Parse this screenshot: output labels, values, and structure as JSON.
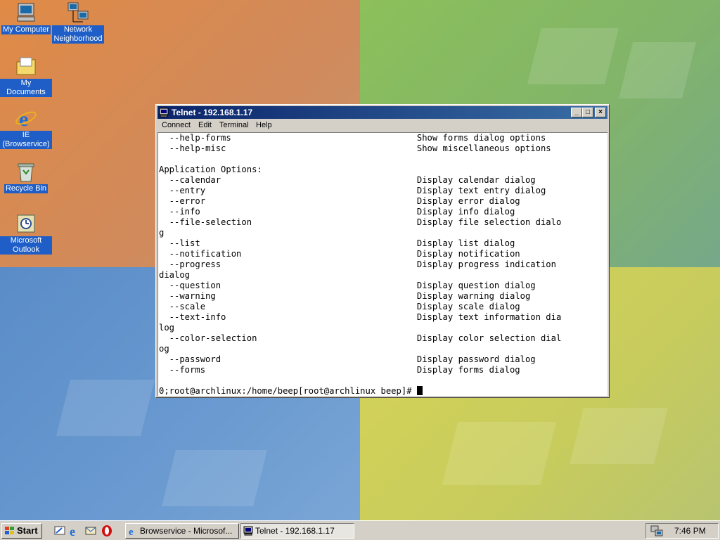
{
  "desktop": {
    "icons": [
      {
        "label": "My Computer",
        "icon": "my-computer-icon"
      },
      {
        "label": "Network Neighborhood",
        "icon": "network-neighborhood-icon"
      },
      {
        "label": "My Documents",
        "icon": "my-documents-icon"
      },
      {
        "label": "IE (Browservice)",
        "icon": "internet-explorer-icon"
      },
      {
        "label": "Recycle Bin",
        "icon": "recycle-bin-icon"
      },
      {
        "label": "Microsoft Outlook",
        "icon": "outlook-icon"
      }
    ]
  },
  "window": {
    "title": "Telnet - 192.168.1.17",
    "buttons": {
      "minimize": "_",
      "maximize": "□",
      "close": "×"
    },
    "menu": [
      "Connect",
      "Edit",
      "Terminal",
      "Help"
    ],
    "terminal_lines": [
      "  --help-forms                                    Show forms dialog options",
      "  --help-misc                                     Show miscellaneous options",
      "",
      "Application Options:",
      "  --calendar                                      Display calendar dialog",
      "  --entry                                         Display text entry dialog",
      "  --error                                         Display error dialog",
      "  --info                                          Display info dialog",
      "  --file-selection                                Display file selection dialo",
      "g",
      "  --list                                          Display list dialog",
      "  --notification                                  Display notification",
      "  --progress                                      Display progress indication",
      "dialog",
      "  --question                                      Display question dialog",
      "  --warning                                       Display warning dialog",
      "  --scale                                         Display scale dialog",
      "  --text-info                                     Display text information dia",
      "log",
      "  --color-selection                               Display color selection dial",
      "og",
      "  --password                                      Display password dialog",
      "  --forms                                         Display forms dialog",
      "",
      "0;root@archlinux:/home/beep[root@archlinux beep]# "
    ]
  },
  "taskbar": {
    "start_label": "Start",
    "quick_launch": [
      "show-desktop-icon",
      "internet-explorer-icon",
      "outlook-express-icon",
      "opera-icon"
    ],
    "tasks": [
      {
        "label": "Browservice - Microsof...",
        "icon": "internet-explorer-icon",
        "active": false
      },
      {
        "label": "Telnet - 192.168.1.17",
        "icon": "telnet-icon",
        "active": true
      }
    ],
    "clock": "7:46 PM"
  }
}
